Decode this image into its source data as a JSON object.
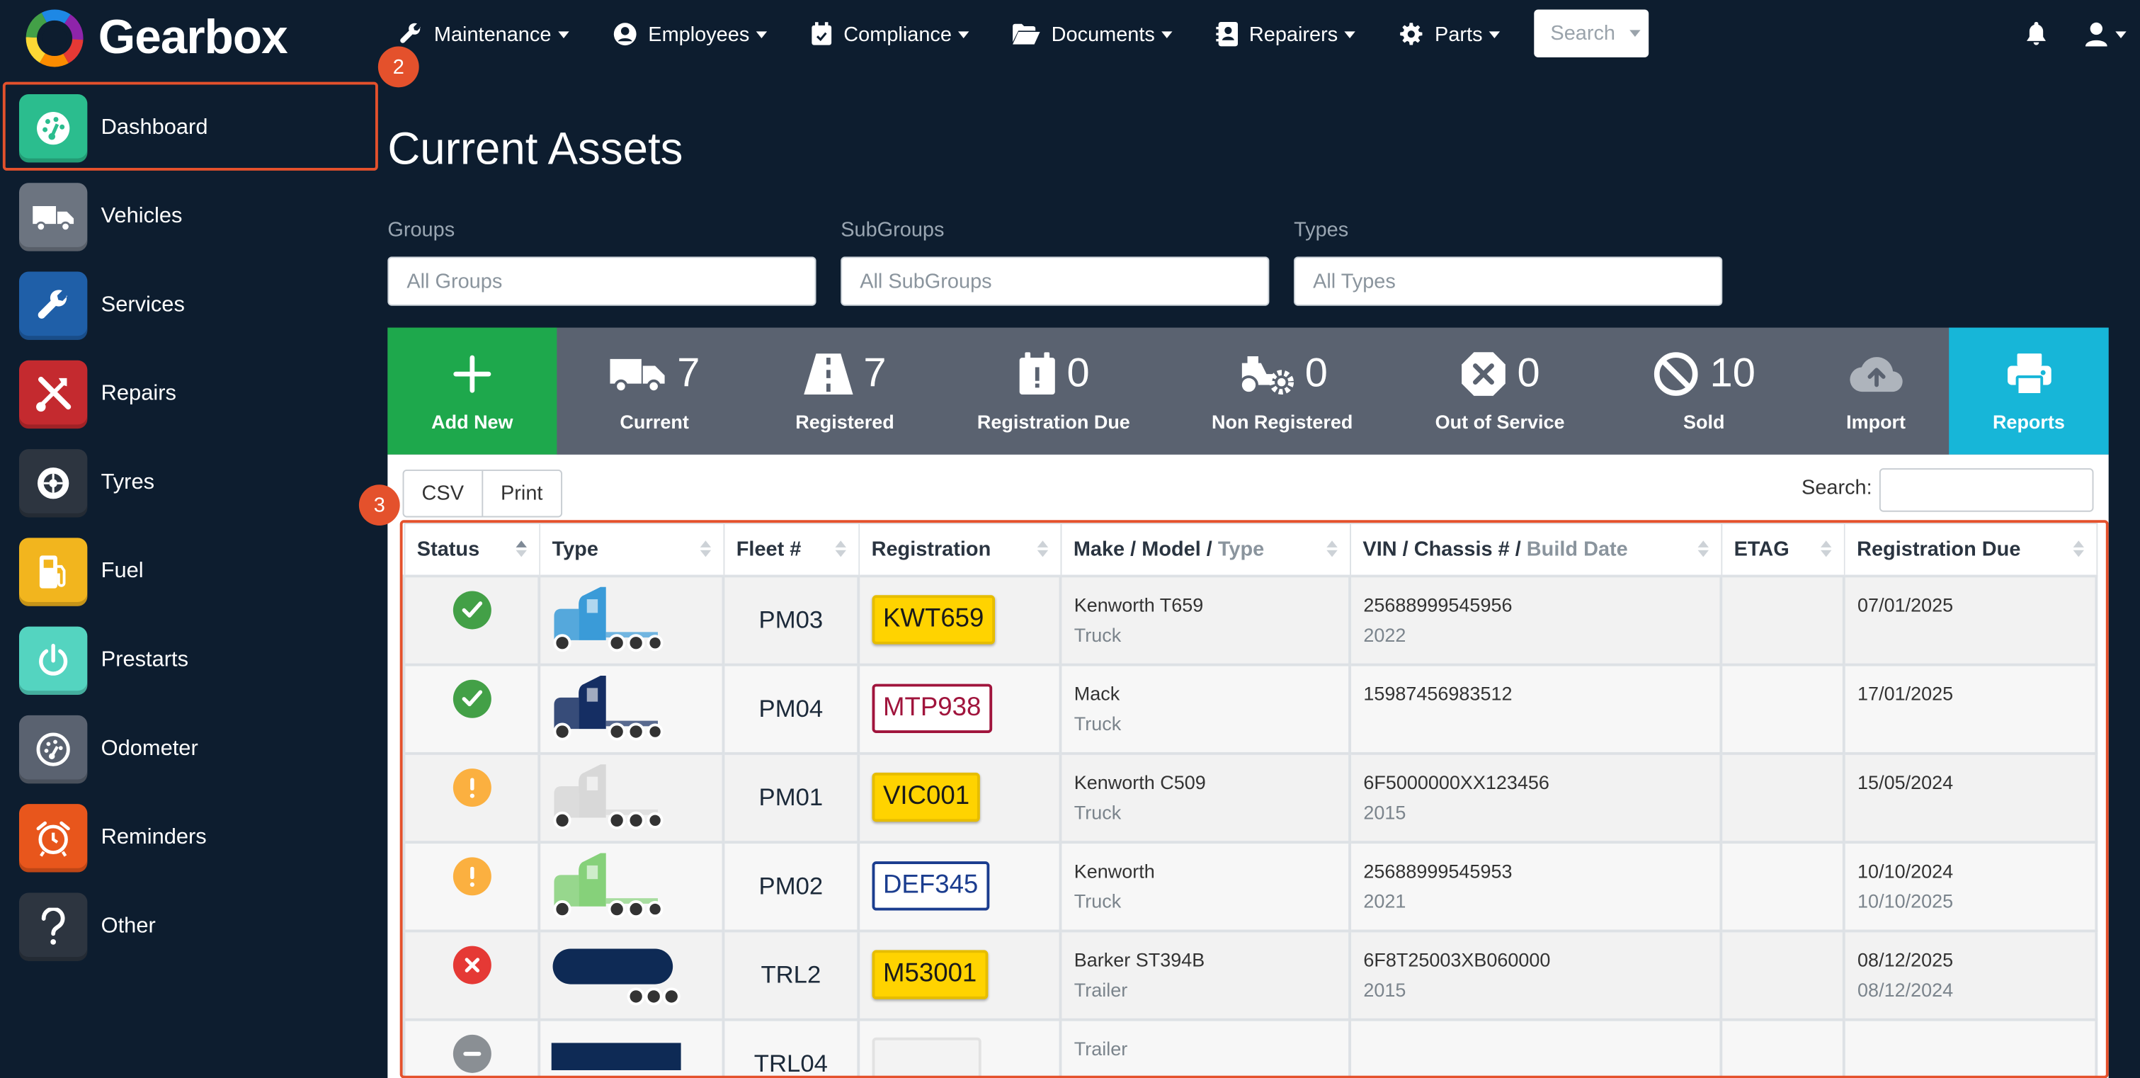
{
  "app": {
    "name": "Gearbox"
  },
  "nav": {
    "items": [
      {
        "label": "Maintenance",
        "icon": "wrench-icon"
      },
      {
        "label": "Employees",
        "icon": "person-circle-icon"
      },
      {
        "label": "Compliance",
        "icon": "calendar-check-icon"
      },
      {
        "label": "Documents",
        "icon": "folder-open-icon"
      },
      {
        "label": "Repairers",
        "icon": "contact-card-icon"
      },
      {
        "label": "Parts",
        "icon": "gear-icon"
      }
    ],
    "search_label": "Search"
  },
  "sidebar": {
    "items": [
      {
        "label": "Dashboard",
        "color": "#2bbd8e",
        "icon": "speedometer-icon"
      },
      {
        "label": "Vehicles",
        "color": "#6c7480",
        "icon": "truck-icon"
      },
      {
        "label": "Services",
        "color": "#1f5fa8",
        "icon": "wrench-icon"
      },
      {
        "label": "Repairs",
        "color": "#c42a2f",
        "icon": "tools-icon"
      },
      {
        "label": "Tyres",
        "color": "#2d3540",
        "icon": "tyre-icon"
      },
      {
        "label": "Fuel",
        "color": "#f2b51e",
        "icon": "fuel-pump-icon"
      },
      {
        "label": "Prestarts",
        "color": "#54d4c0",
        "icon": "power-icon"
      },
      {
        "label": "Odometer",
        "color": "#5a6270",
        "icon": "gauge-icon"
      },
      {
        "label": "Reminders",
        "color": "#e8561c",
        "icon": "alarm-clock-icon"
      },
      {
        "label": "Other",
        "color": "#2d3540",
        "icon": "question-icon"
      }
    ]
  },
  "annotations": {
    "badge_sidebar": "2",
    "badge_table": "3"
  },
  "page": {
    "title": "Current Assets"
  },
  "filters": [
    {
      "label": "Groups",
      "placeholder": "All Groups"
    },
    {
      "label": "SubGroups",
      "placeholder": "All SubGroups"
    },
    {
      "label": "Types",
      "placeholder": "All Types"
    }
  ],
  "stats": [
    {
      "label": "Add New",
      "count": "",
      "icon": "plus-icon",
      "bg": "#1ea84c"
    },
    {
      "label": "Current",
      "count": "7",
      "icon": "truck-icon"
    },
    {
      "label": "Registered",
      "count": "7",
      "icon": "road-icon"
    },
    {
      "label": "Registration Due",
      "count": "0",
      "icon": "calendar-alert-icon"
    },
    {
      "label": "Non Registered",
      "count": "0",
      "icon": "tractor-gear-icon"
    },
    {
      "label": "Out of Service",
      "count": "0",
      "icon": "octagon-x-icon"
    },
    {
      "label": "Sold",
      "count": "10",
      "icon": "ban-icon"
    },
    {
      "label": "Import",
      "count": "",
      "icon": "cloud-upload-icon"
    },
    {
      "label": "Reports",
      "count": "",
      "icon": "printer-icon",
      "bg": "#17b6d8"
    }
  ],
  "table_tools": {
    "csv": "CSV",
    "print": "Print",
    "search_label": "Search:"
  },
  "table": {
    "headers": {
      "status": "Status",
      "type": "Type",
      "fleet": "Fleet #",
      "registration": "Registration",
      "make_model": "Make / Model /",
      "make_model_type": "Type",
      "vin": "VIN / Chassis # /",
      "vin_build": "Build Date",
      "etag": "ETAG",
      "reg_due": "Registration Due"
    },
    "rows": [
      {
        "status": "ok",
        "truck_color": "#3a9bd8",
        "fleet": "PM03",
        "plate": "KWT659",
        "plate_style": "yellow",
        "make": "Kenworth T659",
        "kind": "Truck",
        "vin": "25688999545956",
        "build": "2022",
        "etag": "",
        "due1": "07/01/2025",
        "due2": ""
      },
      {
        "status": "ok",
        "truck_color": "#152e63",
        "fleet": "PM04",
        "plate": "MTP938",
        "plate_style": "red",
        "make": "Mack",
        "kind": "Truck",
        "vin": "15987456983512",
        "build": "",
        "etag": "",
        "due1": "17/01/2025",
        "due2": ""
      },
      {
        "status": "warn",
        "truck_color": "#d8d8d8",
        "fleet": "PM01",
        "plate": "VIC001",
        "plate_style": "yellow",
        "make": "Kenworth C509",
        "kind": "Truck",
        "vin": "6F5000000XX123456",
        "build": "2015",
        "etag": "",
        "due1": "15/05/2024",
        "due2": ""
      },
      {
        "status": "warn",
        "truck_color": "#86d17a",
        "fleet": "PM02",
        "plate": "DEF345",
        "plate_style": "blue",
        "make": "Kenworth",
        "kind": "Truck",
        "vin": "25688999545953",
        "build": "2021",
        "etag": "",
        "due1": "10/10/2024",
        "due2": "10/10/2025"
      },
      {
        "status": "error",
        "truck_color": "#0e2a55",
        "fleet": "TRL2",
        "plate": "M53001",
        "plate_style": "yellow",
        "make": "Barker ST394B",
        "kind": "Trailer",
        "vin": "6F8T25003XB060000",
        "build": "2015",
        "etag": "",
        "due1": "08/12/2025",
        "due2": "08/12/2024"
      },
      {
        "status": "inactive",
        "truck_color": "#0e2a55",
        "fleet": "TRL04",
        "plate": "",
        "plate_style": "blank",
        "make": "",
        "kind": "Trailer",
        "vin": "",
        "build": "",
        "etag": "",
        "due1": "",
        "due2": ""
      }
    ]
  }
}
